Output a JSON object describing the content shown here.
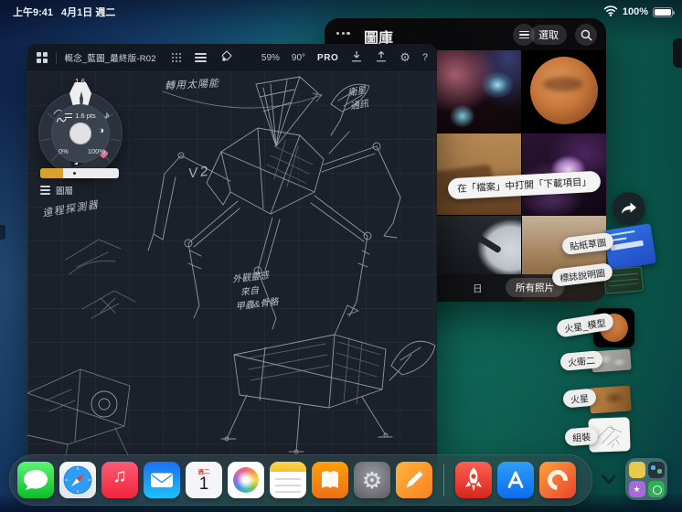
{
  "status_bar": {
    "time": "上午9:41",
    "date": "4月1日 週二",
    "battery_percent": "100%"
  },
  "concepts": {
    "header": {
      "title": "概念_藍圖_最終版-R02",
      "zoom": "59%",
      "rotation": "90°",
      "pro_label": "PRO",
      "help_label": "?"
    },
    "tool_wheel": {
      "active_size": "1.6",
      "size_label": "1.6 pts",
      "opacity_min": "0%",
      "opacity_max": "100%"
    },
    "layers_label": "圖層",
    "annotations": {
      "solar": "轉用太陽能",
      "satellite_line1": "衛星",
      "satellite_line2": "通訊",
      "version": "V2",
      "probe": "遠程探測器",
      "inspiration_line1": "外觀靈感",
      "inspiration_line2": "來自",
      "inspiration_line3": "甲蟲&骨骼"
    }
  },
  "photos": {
    "title": "圖庫",
    "select_label": "選取",
    "tab_day": "日",
    "tab_all": "所有照片",
    "drag_hint": "在「檔案」中打開「下載項目」"
  },
  "drag_labels": {
    "sticker": "貼紙草圖",
    "logo": "標誌說明圖",
    "mars_model": "火星_模型",
    "deimos": "火衛二",
    "mars": "火星",
    "assembly": "組裝"
  },
  "dock": {
    "calendar_weekday": "週二",
    "calendar_day": "1",
    "apps": [
      "messages",
      "safari",
      "music",
      "mail",
      "calendar",
      "photos",
      "notes",
      "books",
      "settings",
      "concepts-pen"
    ],
    "recent_apps": [
      "rocket",
      "app-store",
      "color-swirl"
    ]
  },
  "colors": {
    "accent_gold": "#d7a12c",
    "canvas_background": "#1b212b",
    "wallpaper_teal": "#10695c",
    "photos_background": "#050506"
  }
}
